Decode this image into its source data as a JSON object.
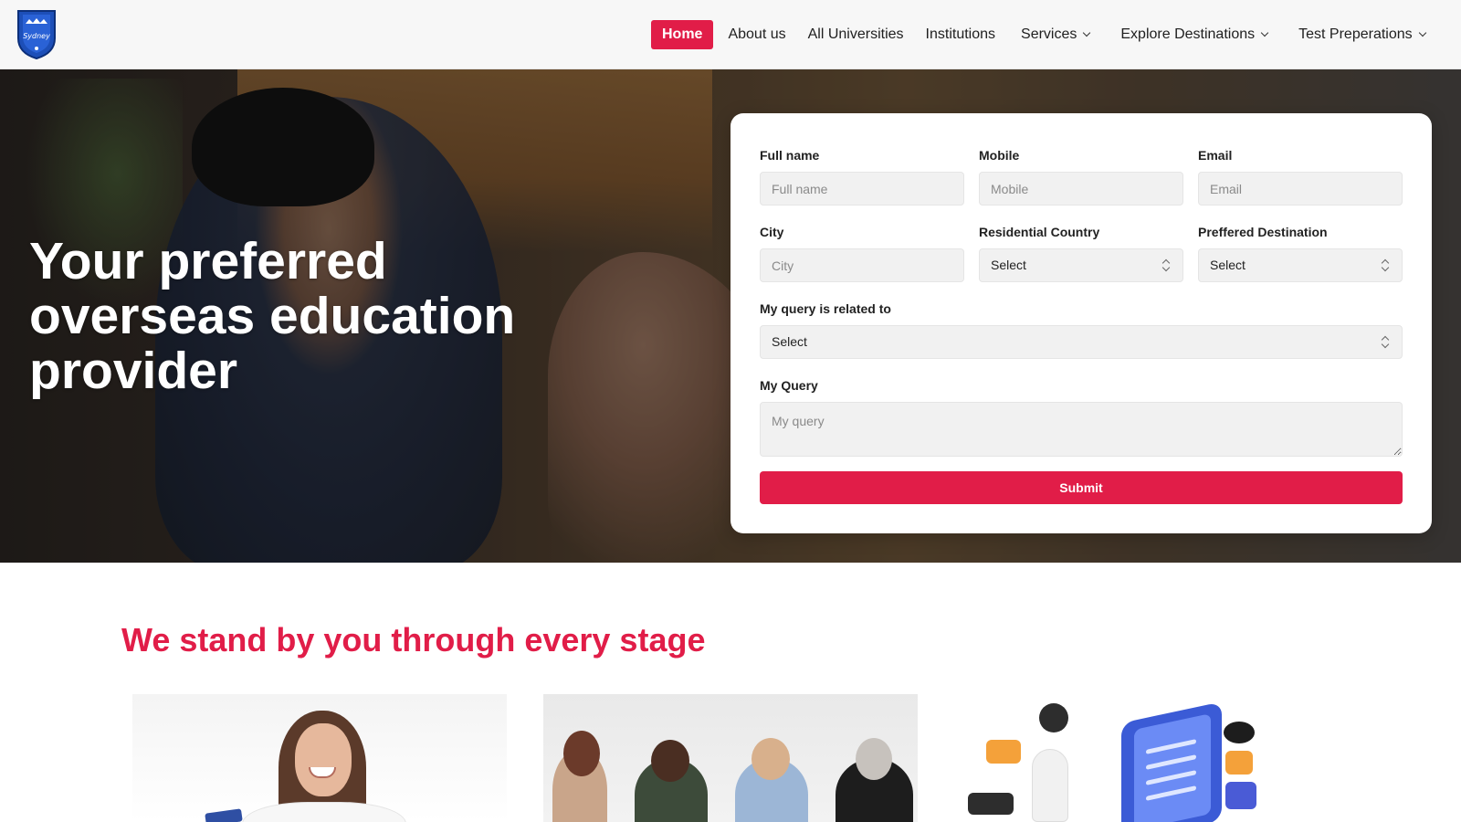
{
  "header": {
    "logo_text": "Sydney",
    "nav": [
      {
        "label": "Home",
        "active": true
      },
      {
        "label": "About us"
      },
      {
        "label": "All Universities"
      },
      {
        "label": "Institutions"
      },
      {
        "label": "Services",
        "dropdown": true
      },
      {
        "label": "Explore Destinations",
        "dropdown": true
      },
      {
        "label": "Test Preperations",
        "dropdown": true
      }
    ]
  },
  "hero": {
    "title": "Your preferred overseas education provider"
  },
  "form": {
    "full_name": {
      "label": "Full name",
      "placeholder": "Full name"
    },
    "mobile": {
      "label": "Mobile",
      "placeholder": "Mobile"
    },
    "email": {
      "label": "Email",
      "placeholder": "Email"
    },
    "city": {
      "label": "City",
      "placeholder": "City"
    },
    "residential_country": {
      "label": "Residential Country",
      "value": "Select"
    },
    "preferred_destination": {
      "label": "Preffered Destination",
      "value": "Select"
    },
    "query_related": {
      "label": "My query is related to",
      "value": "Select"
    },
    "my_query": {
      "label": "My Query",
      "placeholder": "My query"
    },
    "submit_label": "Submit"
  },
  "section": {
    "title": "We stand by you through every stage"
  },
  "colors": {
    "accent": "#e11d48",
    "header_bg": "#f7f7f7",
    "field_bg": "#f1f1f1"
  }
}
